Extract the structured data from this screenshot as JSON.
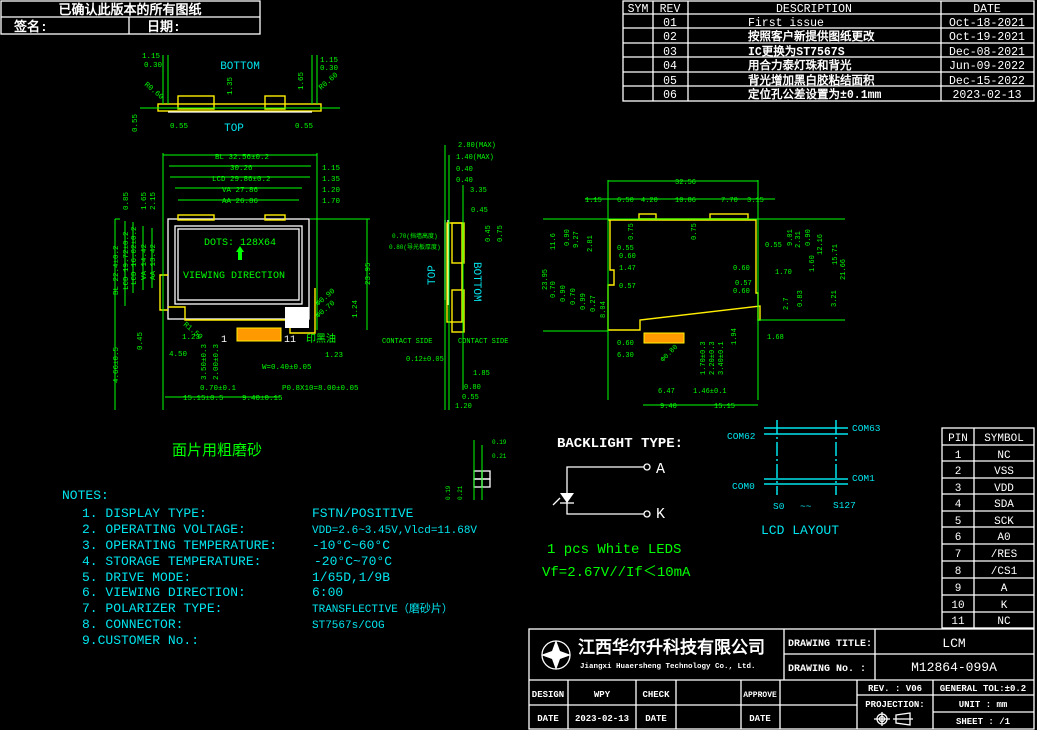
{
  "confirm_box": {
    "title": "已确认此版本的所有图纸",
    "signature_label": "签名:",
    "date_label": "日期:"
  },
  "revision_table": {
    "headers": [
      "SYM",
      "REV",
      "DESCRIPTION",
      "DATE"
    ],
    "rows": [
      {
        "sym": "",
        "rev": "01",
        "description": "First issue",
        "date": "Oct-18-2021"
      },
      {
        "sym": "",
        "rev": "02",
        "description": "按照客户新提供图纸更改",
        "date": "Oct-19-2021"
      },
      {
        "sym": "",
        "rev": "03",
        "description": "IC更换为ST7567S",
        "date": "Dec-08-2021"
      },
      {
        "sym": "",
        "rev": "04",
        "description": "用合力泰灯珠和背光",
        "date": "Jun-09-2022"
      },
      {
        "sym": "",
        "rev": "05",
        "description": "背光增加黑白胶粘结面积",
        "date": "Dec-15-2022"
      },
      {
        "sym": "",
        "rev": "06",
        "description": "定位孔公差设置为±0.1mm",
        "date": "2023-02-13"
      }
    ]
  },
  "top_view": {
    "bottom_label": "BOTTOM",
    "top_label": "TOP",
    "dims": [
      "1.15",
      "0.30",
      "R0.60",
      "1.35",
      "1.65",
      "R0.60",
      "1.15",
      "0.30",
      "0.55",
      "0.55",
      "0.55"
    ]
  },
  "front_view": {
    "dots": "DOTS: 128X64",
    "viewing_direction": "VIEWING DIRECTION",
    "dims": [
      "BL 32.56±0.2",
      "30.26",
      "LCD 29.86±0.2",
      "VA 27.86",
      "AA 26.86",
      "1.15",
      "1.35",
      "1.20",
      "1.70",
      "0.85",
      "1.65",
      "2.15",
      "BL 22.4±0.2",
      "LCD 19.72±0.2",
      "LCD 16.02±0.2",
      "VA 14.42",
      "AA 13.42",
      "23.95",
      "4.66±0.5",
      "0.45",
      "4.50",
      "1.23",
      "R1.50",
      "3.50±0.3",
      "2.00±0.3",
      "W=0.40±0.05",
      "0.70±0.1",
      "P0.8X10=8.00±0.05",
      "15.15±0.5",
      "9.40±0.15",
      "Φ0.90",
      "Φ0.70",
      "1.24",
      "1.23"
    ],
    "pin_first": "1",
    "pin_last": "11",
    "ink_mark": "印黑油"
  },
  "side_view": {
    "top_label": "TOP",
    "bottom_label": "BOTTOM",
    "contact_side_left": "CONTACT SIDE",
    "contact_side_right": "CONTACT SIDE",
    "dims": [
      "2.80(MAX)",
      "1.40(MAX)",
      "0.40",
      "0.40",
      "3.35",
      "0.45",
      "0.45",
      "0.75",
      "0.70(挡墙高度)",
      "0.80(导光板厚度)",
      "0.12±0.05",
      "1.85",
      "0.80",
      "0.55",
      "1.20"
    ]
  },
  "rear_view": {
    "dims": [
      "32.56",
      "1.15",
      "6.50",
      "4.20",
      "10.86",
      "7.70",
      "3.15",
      "0.75",
      "0.75",
      "23.95",
      "11.6",
      "0.90",
      "9.27",
      "2.81",
      "0.55",
      "0.60",
      "1.47",
      "0.57",
      "0.70",
      "0.90",
      "0.70",
      "0.99",
      "0.27",
      "8.04",
      "0.60",
      "6.30",
      "0.55",
      "9.01",
      "2.31",
      "0.90",
      "12.16",
      "15.71",
      "21.66",
      "0.60",
      "1.70",
      "1.60",
      "0.57",
      "0.60",
      "2.7",
      "0.83",
      "3.21",
      "1.94",
      "1.68",
      "Φ0.80",
      "1.70±0.3",
      "2.20±0.3",
      "3.40±0.1",
      "6.47",
      "1.46±0.1",
      "9.40",
      "15.15"
    ]
  },
  "matte_note": "面片用粗磨砂",
  "pixel_detail": {
    "dims": [
      "0.19",
      "0.21",
      "0.19",
      "0.21"
    ]
  },
  "notes": {
    "heading": "NOTES:",
    "items": [
      {
        "label": "1.  DISPLAY TYPE:",
        "value": "FSTN/POSITIVE"
      },
      {
        "label": "2.  OPERATING VOLTAGE:",
        "value": "VDD=2.6~3.45V,Vlcd=11.68V"
      },
      {
        "label": "3.  OPERATING TEMPERATURE:",
        "value": "-10°C~60°C"
      },
      {
        "label": "4.  STORAGE TEMPERATURE:",
        "value": "-20°C~70°C"
      },
      {
        "label": "5.  DRIVE MODE:",
        "value": "1/65D,1/9B"
      },
      {
        "label": "6.  VIEWING DIRECTION:",
        "value": "6:00"
      },
      {
        "label": "7.  POLARIZER TYPE:",
        "value": "TRANSFLECTIVE（磨砂片）"
      },
      {
        "label": "8.  CONNECTOR:",
        "value": "ST7567s/COG"
      },
      {
        "label": "9.CUSTOMER No.:",
        "value": ""
      }
    ]
  },
  "backlight": {
    "title": "BACKLIGHT TYPE:",
    "anode": "A",
    "cathode": "K",
    "led_count": "1 pcs White LEDS",
    "spec": "Vf=2.67V//If＜10mA"
  },
  "lcd_layout": {
    "com62": "COM62",
    "com63": "COM63",
    "com0": "COM0",
    "com1": "COM1",
    "s0": "S0",
    "tilde": "~~",
    "s127": "S127",
    "title": "LCD  LAYOUT"
  },
  "pin_table": {
    "headers": [
      "PIN",
      "SYMBOL"
    ],
    "rows": [
      [
        "1",
        "NC"
      ],
      [
        "2",
        "VSS"
      ],
      [
        "3",
        "VDD"
      ],
      [
        "4",
        "SDA"
      ],
      [
        "5",
        "SCK"
      ],
      [
        "6",
        "A0"
      ],
      [
        "7",
        "/RES"
      ],
      [
        "8",
        "/CS1"
      ],
      [
        "9",
        "A"
      ],
      [
        "10",
        "K"
      ],
      [
        "11",
        "NC"
      ]
    ]
  },
  "title_block": {
    "company_cn": "江西华尔升科技有限公司",
    "company_en": "Jiangxi Huaersheng Technology Co., Ltd.",
    "drawing_title_label": "DRAWING TITLE:",
    "drawing_title": "LCM",
    "drawing_no_label": "DRAWING No. :",
    "drawing_no": "M12864-099A",
    "design_label": "DESIGN",
    "design": "WPY",
    "check_label": "CHECK",
    "approve_label": "APPROVE",
    "date_label": "DATE",
    "date": "2023-02-13",
    "check_date_label": "DATE",
    "approve_date_label": "DATE",
    "rev": "REV. : V06",
    "projection_label": "PROJECTION:",
    "general_tol": "GENERAL TOL:±0.2",
    "unit": "UNIT : mm",
    "sheet": "SHEET :  /1"
  },
  "colors": {
    "background": "#000000",
    "frame": "#ffffff",
    "dimension": "#00ff00",
    "outline": "#ffee00",
    "annotation": "#00e5ee"
  }
}
